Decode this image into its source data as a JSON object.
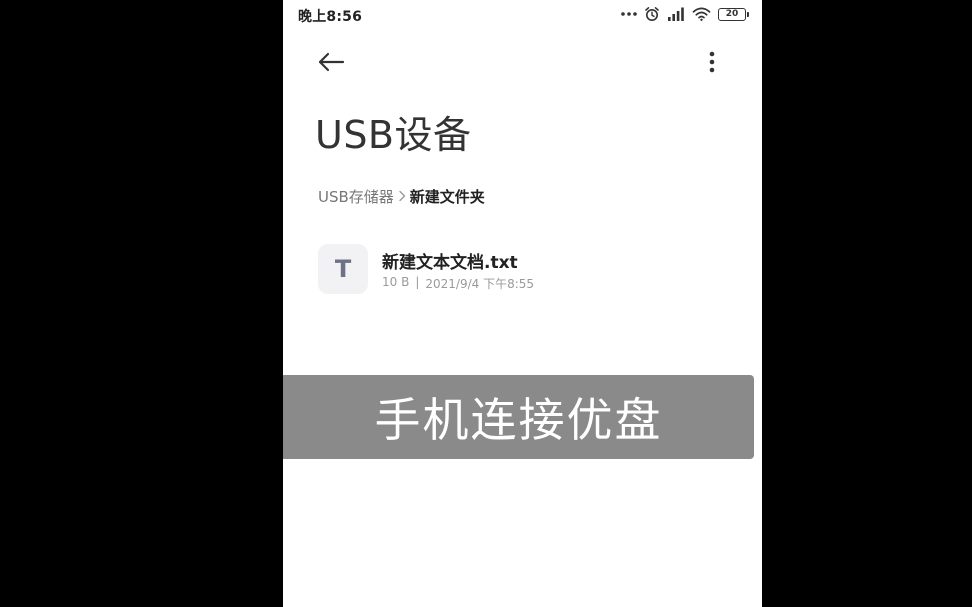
{
  "status_bar": {
    "time": "晚上8:56",
    "battery": "20"
  },
  "header": {
    "title": "USB设备"
  },
  "breadcrumb": {
    "root": "USB存储器",
    "current": "新建文件夹"
  },
  "files": [
    {
      "icon_letter": "T",
      "name": "新建文本文档.txt",
      "size": "10 B",
      "separator": "|",
      "modified": "2021/9/4 下午8:55"
    }
  ],
  "caption": "手机连接优盘",
  "colors": {
    "background": "#000000",
    "screen": "#ffffff",
    "file_icon_bg": "#f2f2f5",
    "file_icon_letter": "#6e7287",
    "caption_bg": "#808080"
  },
  "icons": {
    "back": "arrow-left-icon",
    "more": "more-vertical-icon",
    "chevron": "chevron-right-icon",
    "dots": "notification-dots-icon",
    "alarm": "alarm-icon",
    "signal": "signal-icon",
    "wifi": "wifi-icon"
  }
}
